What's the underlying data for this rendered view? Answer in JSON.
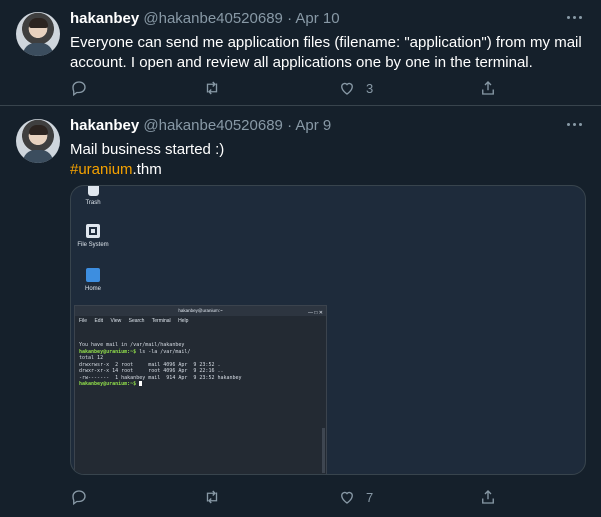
{
  "tweets": [
    {
      "name": "hakanbey",
      "handle": "@hakanbe40520689",
      "sep": "·",
      "date": "Apr 10",
      "text_line1": "Everyone can send me application files (filename: \"application\") from my mail",
      "text_line2": "account. I open and review all applications one by one in the terminal.",
      "like_count": "3"
    },
    {
      "name": "hakanbey",
      "handle": "@hakanbe40520689",
      "sep": "·",
      "date": "Apr 9",
      "text_line1": "Mail business started :)",
      "hashtag": "#uranium",
      "hashtag_suffix": ".thm",
      "like_count": "7",
      "media": {
        "desktop_icons": [
          "Trash",
          "File System",
          "Home"
        ],
        "terminal": {
          "title": "hakanbey@uranium:~",
          "window_buttons": "— □ ✕",
          "menu": [
            "File",
            "Edit",
            "View",
            "Search",
            "Terminal",
            "Help"
          ],
          "lines": [
            {
              "text": ""
            },
            {
              "text": ""
            },
            {
              "text": "You have mail in /var/mail/hakanbey"
            },
            {
              "prompt": "hakanbey@uranium:~$",
              "text": " ls -la /var/mail/"
            },
            {
              "text": "total 12"
            },
            {
              "text": "drwxrwsr-x  2 root     mail 4096 Apr  9 23:52 ."
            },
            {
              "text": "drwxr-xr-x 14 root     root 4096 Apr  9 22:16 .."
            },
            {
              "text": "-rw-------  1 hakanbey mail  914 Apr  9 23:52 hakanbey"
            },
            {
              "prompt": "hakanbey@uranium:~$",
              "text": " "
            }
          ]
        }
      }
    }
  ],
  "icons": {
    "more": "more-horizontal-icon",
    "reply": "reply-icon",
    "retweet": "retweet-icon",
    "like": "heart-icon",
    "share": "share-icon"
  },
  "colors": {
    "background": "#15202b",
    "muted": "#8899a6",
    "hashtag": "#f4a100",
    "border": "#38444d"
  }
}
